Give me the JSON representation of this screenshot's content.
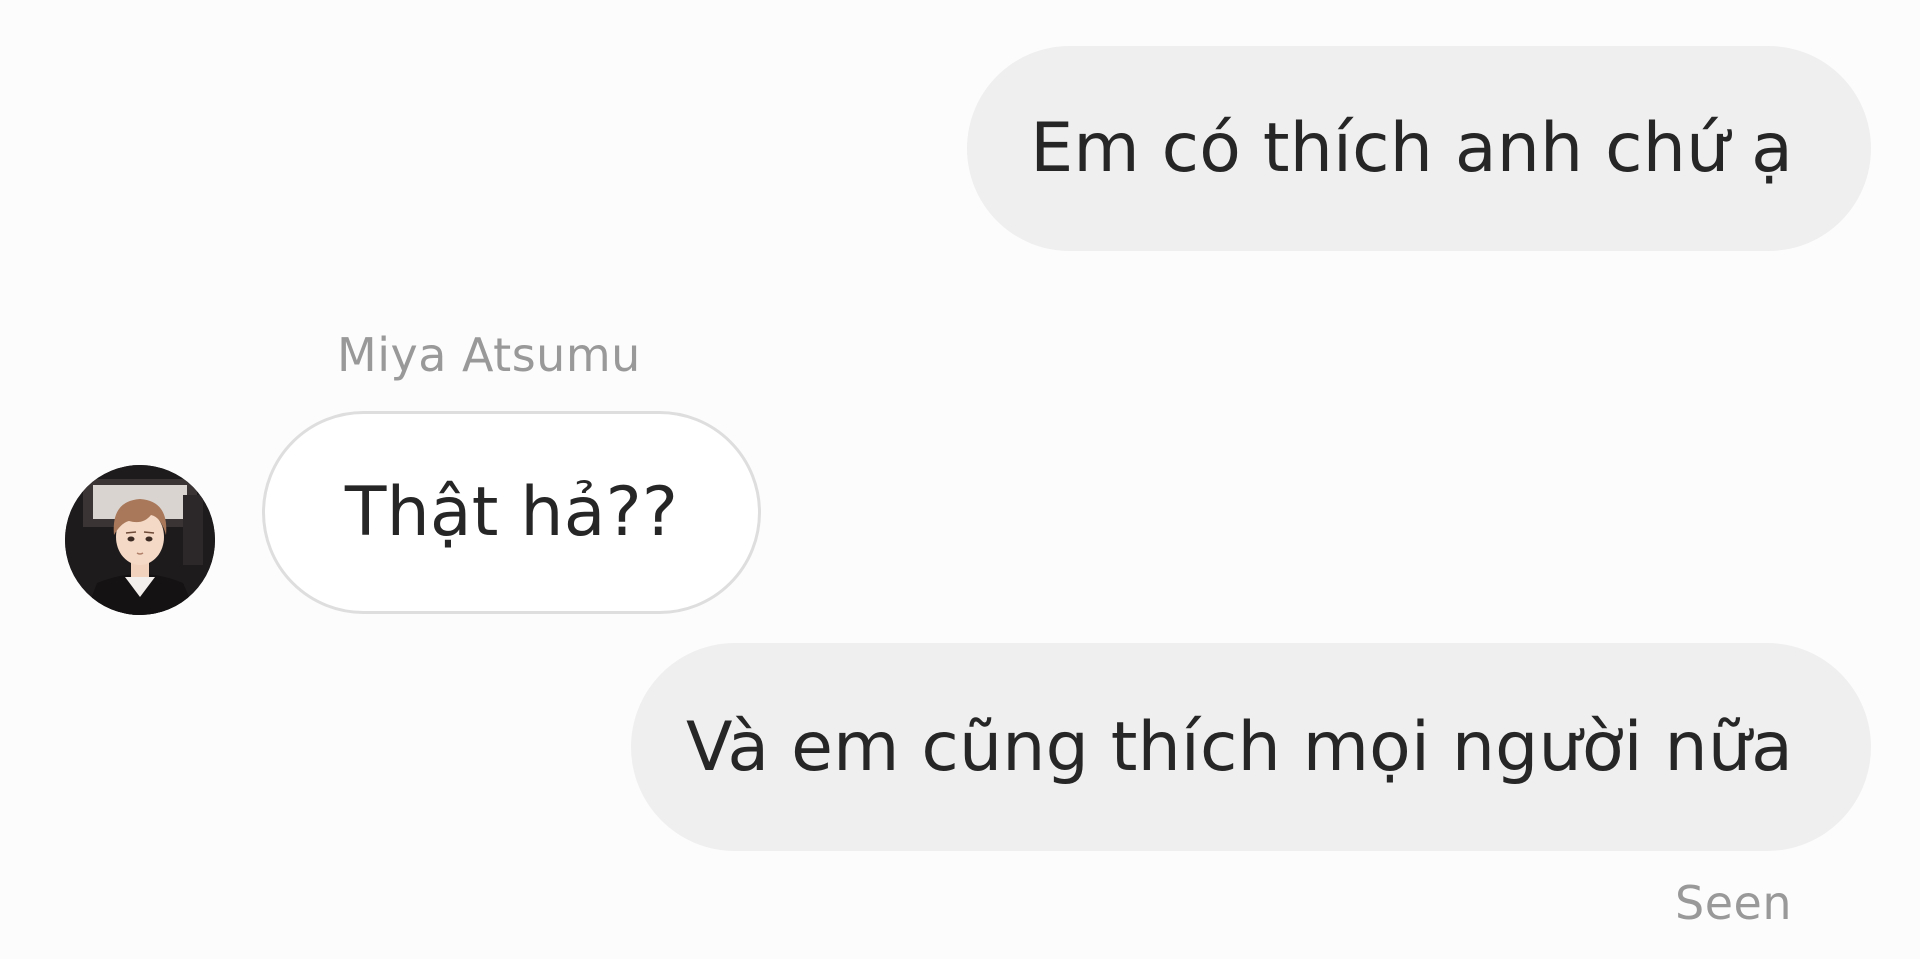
{
  "messages": [
    {
      "direction": "outgoing",
      "text": "Em có thích anh chứ ạ"
    },
    {
      "direction": "incoming",
      "sender": "Miya Atsumu",
      "text": "Thật hả??"
    },
    {
      "direction": "outgoing",
      "text": "Và em cũng thích mọi người nữa"
    }
  ],
  "status": {
    "seen_label": "Seen"
  },
  "avatar": {
    "icon": "anime-character-avatar"
  },
  "colors": {
    "background": "#fcfcfc",
    "outgoing_bubble": "#efefef",
    "incoming_bubble_border": "#dedede",
    "text": "#262626",
    "meta_text": "#999999"
  }
}
